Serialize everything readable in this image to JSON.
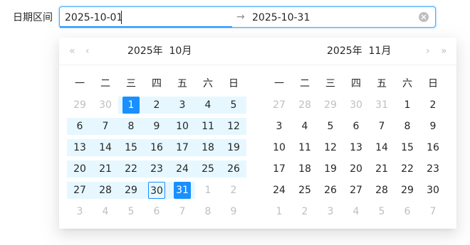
{
  "field": {
    "label": "日期区间"
  },
  "input": {
    "start": "2025-10-01",
    "end": "2025-10-31",
    "separator": "→",
    "clear_icon": "clear-circle-icon"
  },
  "weekdays": [
    "一",
    "二",
    "三",
    "四",
    "五",
    "六",
    "日"
  ],
  "left_panel": {
    "title": "2025年  10月",
    "prev_year": "«",
    "prev_month": "‹",
    "weeks": [
      [
        "29",
        "30",
        "1",
        "2",
        "3",
        "4",
        "5"
      ],
      [
        "6",
        "7",
        "8",
        "9",
        "10",
        "11",
        "12"
      ],
      [
        "13",
        "14",
        "15",
        "16",
        "17",
        "18",
        "19"
      ],
      [
        "20",
        "21",
        "22",
        "23",
        "24",
        "25",
        "26"
      ],
      [
        "27",
        "28",
        "29",
        "30",
        "31",
        "1",
        "2"
      ],
      [
        "3",
        "4",
        "5",
        "6",
        "7",
        "8",
        "9"
      ]
    ]
  },
  "right_panel": {
    "title": "2025年  11月",
    "next_month": "›",
    "next_year": "»",
    "weeks": [
      [
        "27",
        "28",
        "29",
        "30",
        "31",
        "1",
        "2"
      ],
      [
        "3",
        "4",
        "5",
        "6",
        "7",
        "8",
        "9"
      ],
      [
        "10",
        "11",
        "12",
        "13",
        "14",
        "15",
        "16"
      ],
      [
        "17",
        "18",
        "19",
        "20",
        "21",
        "22",
        "23"
      ],
      [
        "24",
        "25",
        "26",
        "27",
        "28",
        "29",
        "30"
      ],
      [
        "1",
        "2",
        "3",
        "4",
        "5",
        "6",
        "7"
      ]
    ]
  },
  "colors": {
    "primary": "#1890ff",
    "range_bg": "#e6f7ff",
    "muted": "#bfbfbf"
  }
}
